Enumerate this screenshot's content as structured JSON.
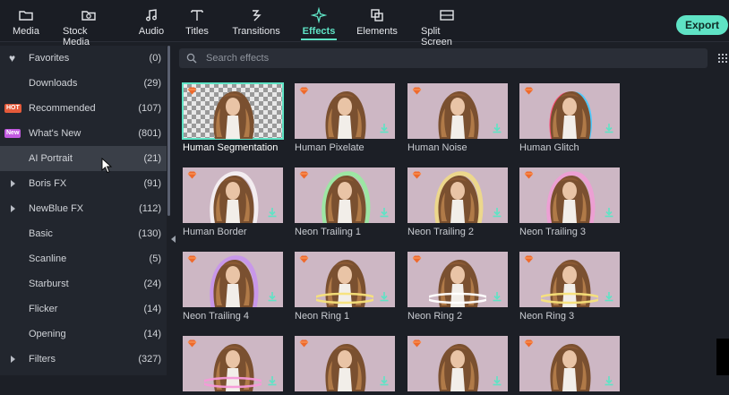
{
  "toolbar": {
    "tabs": [
      {
        "label": "Media",
        "icon": "folder-icon"
      },
      {
        "label": "Stock Media",
        "icon": "stock-media-icon"
      },
      {
        "label": "Audio",
        "icon": "music-note-icon"
      },
      {
        "label": "Titles",
        "icon": "text-t-icon"
      },
      {
        "label": "Transitions",
        "icon": "transitions-icon"
      },
      {
        "label": "Effects",
        "icon": "effects-sparkle-icon",
        "active": true
      },
      {
        "label": "Elements",
        "icon": "elements-icon"
      },
      {
        "label": "Split Screen",
        "icon": "split-screen-icon"
      }
    ],
    "export_label": "Export",
    "accent": "#5fe3c5"
  },
  "sidebar": {
    "items": [
      {
        "label": "Favorites",
        "count": "(0)",
        "lead": "heart-icon"
      },
      {
        "label": "Downloads",
        "count": "(29)"
      },
      {
        "label": "Recommended",
        "count": "(107)",
        "badge": "HOT"
      },
      {
        "label": "What's New",
        "count": "(801)",
        "badge": "New"
      },
      {
        "label": "AI Portrait",
        "count": "(21)",
        "active": true
      },
      {
        "label": "Boris FX",
        "count": "(91)",
        "lead": "expand-arrow-icon"
      },
      {
        "label": "NewBlue FX",
        "count": "(112)",
        "lead": "expand-arrow-icon"
      },
      {
        "label": "Basic",
        "count": "(130)"
      },
      {
        "label": "Scanline",
        "count": "(5)"
      },
      {
        "label": "Starburst",
        "count": "(24)"
      },
      {
        "label": "Flicker",
        "count": "(14)"
      },
      {
        "label": "Opening",
        "count": "(14)"
      },
      {
        "label": "Filters",
        "count": "(327)",
        "lead": "expand-arrow-icon"
      }
    ]
  },
  "search": {
    "placeholder": "Search effects"
  },
  "effects": [
    {
      "name": "Human Segmentation",
      "selected": true,
      "style": "checker"
    },
    {
      "name": "Human Pixelate",
      "style": "plain"
    },
    {
      "name": "Human Noise",
      "style": "plain"
    },
    {
      "name": "Human Glitch",
      "style": "glitch"
    },
    {
      "name": "Human Border",
      "style": "border"
    },
    {
      "name": "Neon Trailing 1",
      "style": "neon-green"
    },
    {
      "name": "Neon Trailing 2",
      "style": "neon-yellow"
    },
    {
      "name": "Neon Trailing 3",
      "style": "neon-pink"
    },
    {
      "name": "Neon Trailing 4",
      "style": "neon-purple"
    },
    {
      "name": "Neon Ring 1",
      "style": "ring-yellow"
    },
    {
      "name": "Neon Ring 2",
      "style": "ring-white"
    },
    {
      "name": "Neon Ring 3",
      "style": "ring-yellow"
    },
    {
      "name": "",
      "style": "ring-pink"
    },
    {
      "name": "",
      "style": "plain"
    },
    {
      "name": "",
      "style": "plain"
    },
    {
      "name": "",
      "style": "plain"
    }
  ]
}
